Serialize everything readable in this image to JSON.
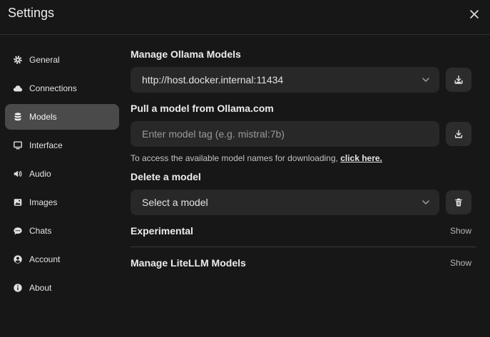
{
  "header": {
    "title": "Settings"
  },
  "sidebar": {
    "items": [
      {
        "label": "General",
        "icon": "gear-icon"
      },
      {
        "label": "Connections",
        "icon": "cloud-icon"
      },
      {
        "label": "Models",
        "icon": "database-icon",
        "active": true
      },
      {
        "label": "Interface",
        "icon": "monitor-icon"
      },
      {
        "label": "Audio",
        "icon": "speaker-icon"
      },
      {
        "label": "Images",
        "icon": "image-icon"
      },
      {
        "label": "Chats",
        "icon": "chat-icon"
      },
      {
        "label": "Account",
        "icon": "user-circle-icon"
      },
      {
        "label": "About",
        "icon": "info-icon"
      }
    ]
  },
  "main": {
    "manage_ollama": {
      "label": "Manage Ollama Models",
      "selected_url": "http://host.docker.internal:11434"
    },
    "pull_model": {
      "label": "Pull a model from Ollama.com",
      "placeholder": "Enter model tag (e.g. mistral:7b)",
      "value": "",
      "hint_text": "To access the available model names for downloading,",
      "hint_link": "click here."
    },
    "delete_model": {
      "label": "Delete a model",
      "selected": "Select a model"
    },
    "experimental": {
      "label": "Experimental",
      "toggle": "Show"
    },
    "litellm": {
      "label": "Manage LiteLLM Models",
      "toggle": "Show"
    }
  },
  "colors": {
    "background": "#171717",
    "active_nav": "#4a4a4a",
    "field_bg": "#282828",
    "button_bg": "#2c2c2c"
  }
}
